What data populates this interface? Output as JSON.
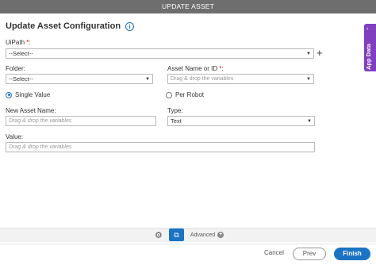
{
  "window": {
    "title": "UPDATE ASSET"
  },
  "form": {
    "heading": "Update Asset Configuration",
    "uipath": {
      "label": "UiPath",
      "required": "*:",
      "value": "--Select--"
    },
    "folder": {
      "label": "Folder:",
      "value": "--Select--"
    },
    "asset_name": {
      "label": "Asset Name or ID",
      "required": "*:",
      "placeholder": "Drag & drop the variables"
    },
    "scope": {
      "single_value": "Single Value",
      "per_robot": "Per Robot",
      "selected": "Single Value"
    },
    "new_asset_name": {
      "label": "New Asset Name:",
      "placeholder": "Drag & drop the variables"
    },
    "type": {
      "label": "Type:",
      "value": "Text"
    },
    "value": {
      "label": "Value:",
      "placeholder": "Drag & drop the variables"
    }
  },
  "side_panel": {
    "label": "App Data",
    "chevron": "‹"
  },
  "toolbar": {
    "advanced_label": "Advanced",
    "gear_glyph": "⚙",
    "preview_glyph": "⧉",
    "plus_glyph": "+"
  },
  "footer": {
    "cancel": "Cancel",
    "prev": "Prev",
    "finish": "Finish"
  },
  "colors": {
    "accent": "#1a73c4",
    "side_panel": "#7f3fbf",
    "titlebar": "#6e6e6e"
  }
}
